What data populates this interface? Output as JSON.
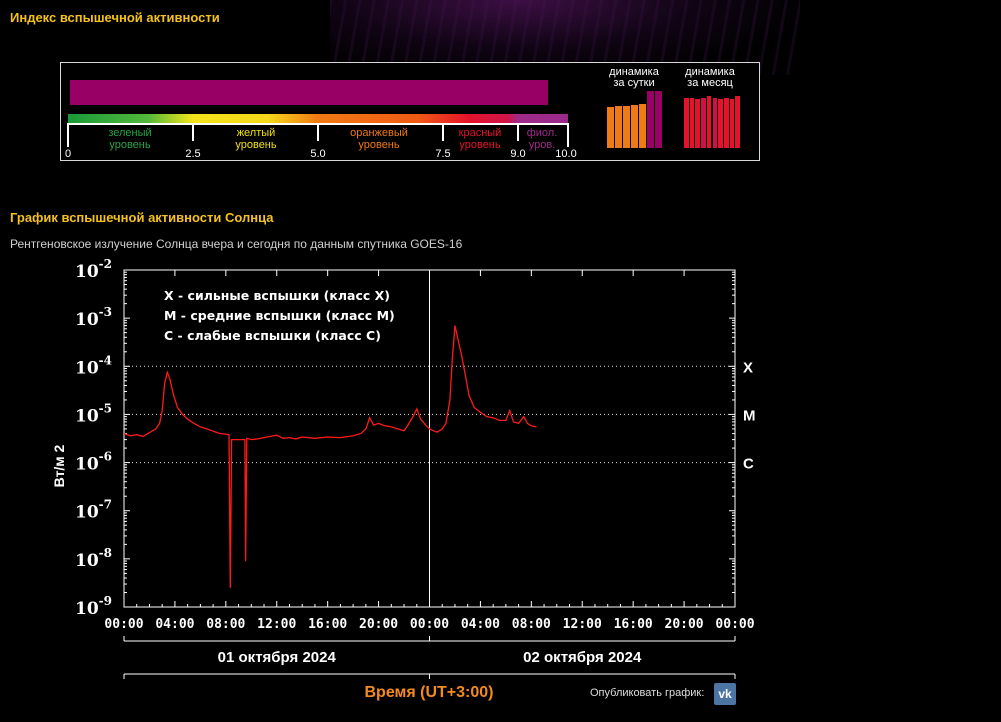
{
  "header": {
    "index_title": "Индекс вспышечной активности",
    "chart_title": "График вспышечной активности Солнца",
    "subtitle": "Рентгеновское излучение Солнца вчера и сегодня по данным спутника GOES-16"
  },
  "index_panel": {
    "current_value": 9.6,
    "scale_max": 10.0,
    "bar_color": "#990066",
    "levels": [
      {
        "line1": "зеленый",
        "line2": "уровень",
        "color": "#27a448"
      },
      {
        "line1": "желтый",
        "line2": "уровень",
        "color": "#f2e210"
      },
      {
        "line1": "оранжевый",
        "line2": "уровень",
        "color": "#f07a14"
      },
      {
        "line1": "красный",
        "line2": "уровень",
        "color": "#e5132a"
      },
      {
        "line1": "фиол.",
        "line2": "уров.",
        "color": "#a02a8a"
      }
    ],
    "ticks": [
      "0",
      "2.5",
      "5.0",
      "7.5",
      "9.0",
      "10.0"
    ],
    "daily_dynamics": {
      "title_line1": "динамика",
      "title_line2": "за сутки",
      "values": [
        5.5,
        5.7,
        5.7,
        5.8,
        6.0,
        7.7,
        7.7
      ],
      "colors": [
        "#f07a14",
        "#f07a14",
        "#f07a14",
        "#f07a14",
        "#f07a14",
        "#990066",
        "#990066"
      ]
    },
    "monthly_dynamics": {
      "title_line1": "динамика",
      "title_line2": "за месяц",
      "values": [
        6.8,
        6.8,
        6.6,
        6.8,
        7.0,
        6.8,
        6.6,
        6.8,
        6.6,
        7.0
      ],
      "colors": [
        "#e5132a",
        "#e5132a",
        "#e5132a",
        "#d0104a",
        "#e5132a",
        "#d0104a",
        "#e5132a",
        "#e5132a",
        "#e5132a",
        "#e5132a"
      ]
    }
  },
  "chart_data": {
    "type": "line",
    "ylabel": "Вт/м 2",
    "xlabel": "Время (UT+3:00)",
    "yscale": "log",
    "ylim": [
      1e-09,
      0.01
    ],
    "y_ticks": [
      {
        "base": "10",
        "exp": "-2"
      },
      {
        "base": "10",
        "exp": "-3"
      },
      {
        "base": "10",
        "exp": "-4"
      },
      {
        "base": "10",
        "exp": "-5"
      },
      {
        "base": "10",
        "exp": "-6"
      },
      {
        "base": "10",
        "exp": "-7"
      },
      {
        "base": "10",
        "exp": "-8"
      },
      {
        "base": "10",
        "exp": "-9"
      }
    ],
    "x_range_hours": [
      0,
      48
    ],
    "x_tick_labels": [
      "00:00",
      "04:00",
      "08:00",
      "12:00",
      "16:00",
      "20:00",
      "00:00",
      "04:00",
      "08:00",
      "12:00",
      "16:00",
      "20:00",
      "00:00"
    ],
    "day_labels": [
      "01 октября 2024",
      "02 октября 2024"
    ],
    "class_lines": [
      {
        "label": "X",
        "value": 0.0001
      },
      {
        "label": "M",
        "value": 1e-05
      },
      {
        "label": "C",
        "value": 1e-06
      }
    ],
    "legend": [
      "X - сильные вспышки (класс X)",
      "M - средние вспышки (класс M)",
      "C - слабые вспышки (класс C)"
    ],
    "series": [
      {
        "color": "#ff1a1a",
        "points": [
          [
            0.0,
            4e-06
          ],
          [
            0.5,
            3.6e-06
          ],
          [
            1.0,
            3.8e-06
          ],
          [
            1.5,
            3.5e-06
          ],
          [
            2.0,
            4.2e-06
          ],
          [
            2.5,
            5e-06
          ],
          [
            2.8,
            6.5e-06
          ],
          [
            3.0,
            1.2e-05
          ],
          [
            3.2,
            4.5e-05
          ],
          [
            3.4,
            7.5e-05
          ],
          [
            3.6,
            5.5e-05
          ],
          [
            3.9,
            2.5e-05
          ],
          [
            4.2,
            1.4e-05
          ],
          [
            4.6,
            1e-05
          ],
          [
            5.0,
            8e-06
          ],
          [
            5.5,
            6.5e-06
          ],
          [
            6.0,
            5.5e-06
          ],
          [
            6.5,
            5e-06
          ],
          [
            7.0,
            4.5e-06
          ],
          [
            7.3,
            4.2e-06
          ],
          [
            7.6,
            4e-06
          ],
          [
            8.0,
            3.9e-06
          ],
          [
            8.25,
            3.8e-06
          ],
          [
            8.35,
            2.5e-09
          ],
          [
            8.45,
            3e-06
          ],
          [
            8.8,
            3e-06
          ],
          [
            9.2,
            3e-06
          ],
          [
            9.5,
            3e-06
          ],
          [
            9.55,
            9e-09
          ],
          [
            9.65,
            3.2e-06
          ],
          [
            10.0,
            3e-06
          ],
          [
            10.5,
            3.1e-06
          ],
          [
            11.0,
            3.3e-06
          ],
          [
            11.5,
            3.5e-06
          ],
          [
            12.0,
            3.7e-06
          ],
          [
            12.5,
            3.2e-06
          ],
          [
            13.0,
            3.3e-06
          ],
          [
            13.5,
            3.1e-06
          ],
          [
            14.0,
            3.4e-06
          ],
          [
            15.0,
            3.2e-06
          ],
          [
            16.0,
            3.4e-06
          ],
          [
            17.0,
            3.3e-06
          ],
          [
            18.0,
            3.6e-06
          ],
          [
            18.6,
            4e-06
          ],
          [
            19.0,
            5e-06
          ],
          [
            19.3,
            8.5e-06
          ],
          [
            19.6,
            6e-06
          ],
          [
            20.0,
            6.5e-06
          ],
          [
            20.5,
            5.8e-06
          ],
          [
            21.0,
            5.5e-06
          ],
          [
            21.5,
            5e-06
          ],
          [
            22.0,
            4.6e-06
          ],
          [
            22.3,
            6e-06
          ],
          [
            22.7,
            9e-06
          ],
          [
            23.0,
            1.3e-05
          ],
          [
            23.3,
            8e-06
          ],
          [
            23.7,
            6e-06
          ],
          [
            24.0,
            5e-06
          ],
          [
            24.3,
            4.6e-06
          ],
          [
            24.6,
            4.3e-06
          ],
          [
            25.0,
            5e-06
          ],
          [
            25.3,
            6.5e-06
          ],
          [
            25.6,
            2e-05
          ],
          [
            25.8,
            0.00015
          ],
          [
            26.0,
            0.0007
          ],
          [
            26.2,
            0.0004
          ],
          [
            26.5,
            0.00018
          ],
          [
            26.8,
            7e-05
          ],
          [
            27.1,
            2.5e-05
          ],
          [
            27.5,
            1.4e-05
          ],
          [
            28.0,
            1.1e-05
          ],
          [
            28.5,
            9e-06
          ],
          [
            29.0,
            8.5e-06
          ],
          [
            29.5,
            7.5e-06
          ],
          [
            30.0,
            7.5e-06
          ],
          [
            30.3,
            1.2e-05
          ],
          [
            30.6,
            7e-06
          ],
          [
            31.0,
            6.5e-06
          ],
          [
            31.4,
            9e-06
          ],
          [
            31.7,
            6.5e-06
          ],
          [
            32.0,
            5.8e-06
          ],
          [
            32.4,
            5.5e-06
          ]
        ]
      }
    ]
  },
  "footer": {
    "publish_label": "Опубликовать график:",
    "vk_label": "vk"
  }
}
